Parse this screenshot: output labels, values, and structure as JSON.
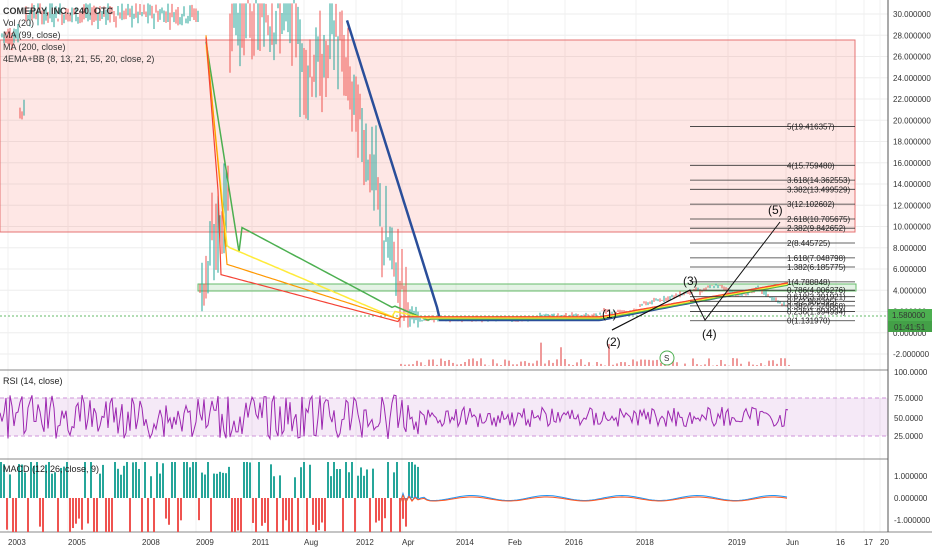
{
  "header": {
    "title": "COMEPAY, INC., 240, OTC",
    "indicators": [
      "Vol (20)",
      "MA (99, close)",
      "MA (200, close)",
      "4EMA+BB (8, 13, 21, 55, 20, close, 2)"
    ]
  },
  "price_axis": {
    "ticks": [
      "30.000000",
      "28.000000",
      "26.000000",
      "24.000000",
      "22.000000",
      "20.000000",
      "18.000000",
      "16.000000",
      "14.000000",
      "12.000000",
      "10.000000",
      "8.000000",
      "6.000000",
      "4.000000",
      "2.000000",
      "0.000000",
      "-2.000000"
    ],
    "last_price": "1.580000",
    "countdown": "01:41:51"
  },
  "time_axis": {
    "ticks": [
      "2003",
      "2005",
      "2008",
      "2009",
      "2011",
      "Aug",
      "2012",
      "Apr",
      "2014",
      "Feb",
      "2016",
      "2018",
      "2019",
      "Jun",
      "16",
      "17",
      "20"
    ]
  },
  "fib_levels": [
    {
      "ratio": "5",
      "label": "5(19.416357)"
    },
    {
      "ratio": "4",
      "label": "4(15.759480)"
    },
    {
      "ratio": "3.618",
      "label": "3.618(14.362553)"
    },
    {
      "ratio": "3.382",
      "label": "3.382(13.499529)"
    },
    {
      "ratio": "3",
      "label": "3(12.102602)"
    },
    {
      "ratio": "2.618",
      "label": "2.618(10.705675)"
    },
    {
      "ratio": "2.382",
      "label": "2.382(9.842652)"
    },
    {
      "ratio": "2",
      "label": "2(8.445725)"
    },
    {
      "ratio": "1.618",
      "label": "1.618(7.048798)"
    },
    {
      "ratio": "1.382",
      "label": "1.382(6.185775)"
    },
    {
      "ratio": "1",
      "label": "1(4.788848)"
    },
    {
      "ratio": "0.786",
      "label": "0.786(4.006276)"
    },
    {
      "ratio": "0.618",
      "label": "0.618(3.391921)"
    },
    {
      "ratio": "0.5",
      "label": "0.5(2.960395)"
    },
    {
      "ratio": "0.382",
      "label": "0.382(2.528868)"
    },
    {
      "ratio": "0.236",
      "label": "0.236(1.994994)"
    },
    {
      "ratio": "0",
      "label": "0(1.131970)"
    }
  ],
  "waves": [
    "(1)",
    "(2)",
    "(3)",
    "(4)",
    "(5)"
  ],
  "rsi": {
    "title": "RSI (14, close)",
    "ticks": [
      "100.0000",
      "75.0000",
      "50.0000",
      "25.0000"
    ]
  },
  "macd": {
    "title": "MACD (12, 26, close, 9)",
    "ticks": [
      "1.000000",
      "0.000000",
      "-1.000000"
    ]
  },
  "colors": {
    "rsi_line": "#9c27b0",
    "macd_line": "#2196f3",
    "signal_line": "#ff5722",
    "hist_up": "#26a69a",
    "hist_down": "#ef5350",
    "ma_slow": "#2a4e9a",
    "ema_green": "#4caf50",
    "ema_yellow": "#ffeb3b",
    "ema_orange": "#ff9800",
    "ema_red": "#f44336",
    "zone_fill": "rgba(244,67,54,0.13)"
  },
  "badge": "S",
  "chart_data": {
    "type": "line",
    "title": "COMEPAY, INC., 240, OTC",
    "x": [
      "2003",
      "2005",
      "2008",
      "2009",
      "2011",
      "Aug",
      "2012",
      "Apr",
      "2014",
      "Feb",
      "2016",
      "2018",
      "2019",
      "Jun"
    ],
    "series": [
      {
        "name": "MA (200, close)",
        "values": [
          null,
          null,
          null,
          null,
          null,
          null,
          29,
          20,
          1.2,
          1.0,
          1.4,
          2.3,
          4.2,
          3.0
        ]
      },
      {
        "name": "MA (99, close)",
        "values": [
          null,
          null,
          null,
          18,
          16,
          14,
          12,
          4.0,
          1.3,
          1.1,
          1.5,
          2.4,
          4.3,
          2.9
        ]
      }
    ],
    "ylim": [
      -2,
      31
    ],
    "last_price": 1.58,
    "fib_extension": [
      19.416357,
      15.75948,
      14.362553,
      13.499529,
      12.102602,
      10.705675,
      9.842652,
      8.445725,
      7.048798,
      6.185775,
      4.788848,
      4.006276,
      3.391921,
      2.960395,
      2.528868,
      1.994994,
      1.13197
    ],
    "subcharts": [
      {
        "type": "line",
        "title": "RSI (14, close)",
        "ylim": [
          0,
          100
        ],
        "band": [
          30,
          70
        ]
      },
      {
        "type": "bar",
        "title": "MACD (12, 26, close, 9)",
        "ylim": [
          -1.5,
          1.5
        ]
      }
    ]
  }
}
